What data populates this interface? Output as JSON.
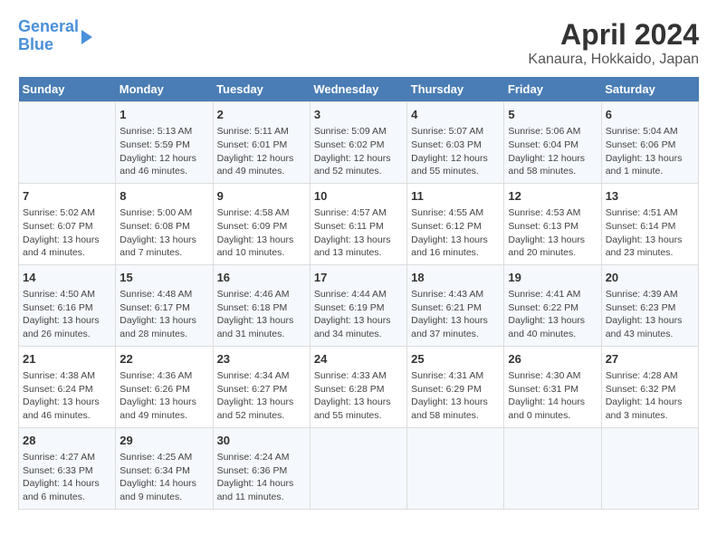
{
  "logo": {
    "line1": "General",
    "line2": "Blue"
  },
  "title": "April 2024",
  "subtitle": "Kanaura, Hokkaido, Japan",
  "days_of_week": [
    "Sunday",
    "Monday",
    "Tuesday",
    "Wednesday",
    "Thursday",
    "Friday",
    "Saturday"
  ],
  "weeks": [
    [
      {
        "day": "",
        "info": ""
      },
      {
        "day": "1",
        "info": "Sunrise: 5:13 AM\nSunset: 5:59 PM\nDaylight: 12 hours\nand 46 minutes."
      },
      {
        "day": "2",
        "info": "Sunrise: 5:11 AM\nSunset: 6:01 PM\nDaylight: 12 hours\nand 49 minutes."
      },
      {
        "day": "3",
        "info": "Sunrise: 5:09 AM\nSunset: 6:02 PM\nDaylight: 12 hours\nand 52 minutes."
      },
      {
        "day": "4",
        "info": "Sunrise: 5:07 AM\nSunset: 6:03 PM\nDaylight: 12 hours\nand 55 minutes."
      },
      {
        "day": "5",
        "info": "Sunrise: 5:06 AM\nSunset: 6:04 PM\nDaylight: 12 hours\nand 58 minutes."
      },
      {
        "day": "6",
        "info": "Sunrise: 5:04 AM\nSunset: 6:06 PM\nDaylight: 13 hours\nand 1 minute."
      }
    ],
    [
      {
        "day": "7",
        "info": "Sunrise: 5:02 AM\nSunset: 6:07 PM\nDaylight: 13 hours\nand 4 minutes."
      },
      {
        "day": "8",
        "info": "Sunrise: 5:00 AM\nSunset: 6:08 PM\nDaylight: 13 hours\nand 7 minutes."
      },
      {
        "day": "9",
        "info": "Sunrise: 4:58 AM\nSunset: 6:09 PM\nDaylight: 13 hours\nand 10 minutes."
      },
      {
        "day": "10",
        "info": "Sunrise: 4:57 AM\nSunset: 6:11 PM\nDaylight: 13 hours\nand 13 minutes."
      },
      {
        "day": "11",
        "info": "Sunrise: 4:55 AM\nSunset: 6:12 PM\nDaylight: 13 hours\nand 16 minutes."
      },
      {
        "day": "12",
        "info": "Sunrise: 4:53 AM\nSunset: 6:13 PM\nDaylight: 13 hours\nand 20 minutes."
      },
      {
        "day": "13",
        "info": "Sunrise: 4:51 AM\nSunset: 6:14 PM\nDaylight: 13 hours\nand 23 minutes."
      }
    ],
    [
      {
        "day": "14",
        "info": "Sunrise: 4:50 AM\nSunset: 6:16 PM\nDaylight: 13 hours\nand 26 minutes."
      },
      {
        "day": "15",
        "info": "Sunrise: 4:48 AM\nSunset: 6:17 PM\nDaylight: 13 hours\nand 28 minutes."
      },
      {
        "day": "16",
        "info": "Sunrise: 4:46 AM\nSunset: 6:18 PM\nDaylight: 13 hours\nand 31 minutes."
      },
      {
        "day": "17",
        "info": "Sunrise: 4:44 AM\nSunset: 6:19 PM\nDaylight: 13 hours\nand 34 minutes."
      },
      {
        "day": "18",
        "info": "Sunrise: 4:43 AM\nSunset: 6:21 PM\nDaylight: 13 hours\nand 37 minutes."
      },
      {
        "day": "19",
        "info": "Sunrise: 4:41 AM\nSunset: 6:22 PM\nDaylight: 13 hours\nand 40 minutes."
      },
      {
        "day": "20",
        "info": "Sunrise: 4:39 AM\nSunset: 6:23 PM\nDaylight: 13 hours\nand 43 minutes."
      }
    ],
    [
      {
        "day": "21",
        "info": "Sunrise: 4:38 AM\nSunset: 6:24 PM\nDaylight: 13 hours\nand 46 minutes."
      },
      {
        "day": "22",
        "info": "Sunrise: 4:36 AM\nSunset: 6:26 PM\nDaylight: 13 hours\nand 49 minutes."
      },
      {
        "day": "23",
        "info": "Sunrise: 4:34 AM\nSunset: 6:27 PM\nDaylight: 13 hours\nand 52 minutes."
      },
      {
        "day": "24",
        "info": "Sunrise: 4:33 AM\nSunset: 6:28 PM\nDaylight: 13 hours\nand 55 minutes."
      },
      {
        "day": "25",
        "info": "Sunrise: 4:31 AM\nSunset: 6:29 PM\nDaylight: 13 hours\nand 58 minutes."
      },
      {
        "day": "26",
        "info": "Sunrise: 4:30 AM\nSunset: 6:31 PM\nDaylight: 14 hours\nand 0 minutes."
      },
      {
        "day": "27",
        "info": "Sunrise: 4:28 AM\nSunset: 6:32 PM\nDaylight: 14 hours\nand 3 minutes."
      }
    ],
    [
      {
        "day": "28",
        "info": "Sunrise: 4:27 AM\nSunset: 6:33 PM\nDaylight: 14 hours\nand 6 minutes."
      },
      {
        "day": "29",
        "info": "Sunrise: 4:25 AM\nSunset: 6:34 PM\nDaylight: 14 hours\nand 9 minutes."
      },
      {
        "day": "30",
        "info": "Sunrise: 4:24 AM\nSunset: 6:36 PM\nDaylight: 14 hours\nand 11 minutes."
      },
      {
        "day": "",
        "info": ""
      },
      {
        "day": "",
        "info": ""
      },
      {
        "day": "",
        "info": ""
      },
      {
        "day": "",
        "info": ""
      }
    ]
  ]
}
